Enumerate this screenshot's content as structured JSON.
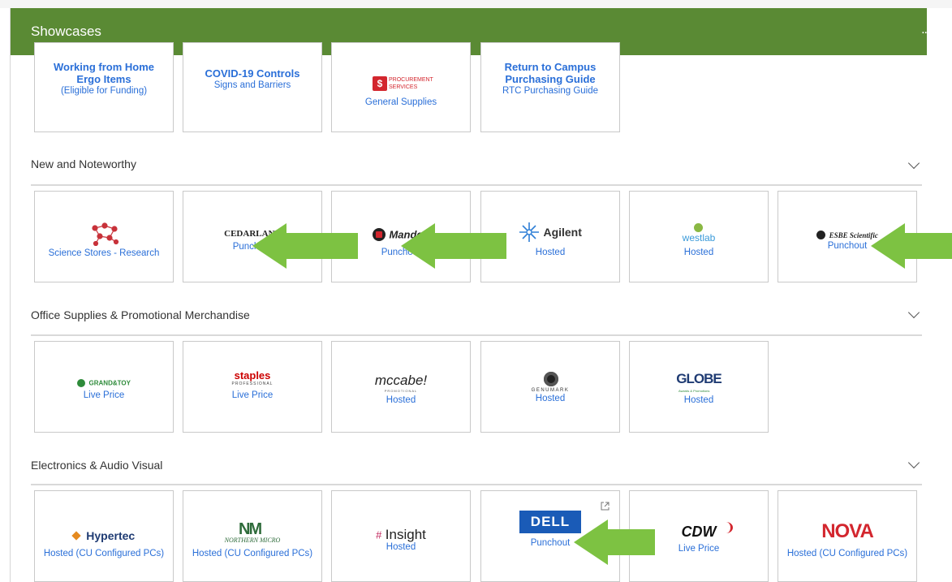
{
  "header": {
    "title": "Showcases",
    "more_label": ".."
  },
  "showcase_tiles": [
    {
      "title_line1": "Working from Home",
      "title_line2": "Ergo Items",
      "caption": "(Eligible for Funding)"
    },
    {
      "title_line1": "COVID-19 Controls",
      "caption": "Signs and Barriers"
    },
    {
      "logo_line1": "PROCUREMENT",
      "logo_line2": "SERVICES",
      "caption": "General Supplies"
    },
    {
      "title_line1": "Return to Campus",
      "title_line2": "Purchasing Guide",
      "caption": "RTC Purchasing Guide"
    }
  ],
  "sections": [
    {
      "title": "New and Noteworthy",
      "tiles": [
        {
          "logo": "",
          "caption": "Science Stores - Research"
        },
        {
          "logo": "CEDARLANE",
          "caption": "Punchout"
        },
        {
          "logo": "Mandel",
          "caption": "Punchout"
        },
        {
          "logo": "Agilent",
          "caption": "Hosted"
        },
        {
          "logo": "westlab",
          "caption": "Hosted"
        },
        {
          "logo": "ESBE Scientific",
          "caption": "Punchout"
        }
      ]
    },
    {
      "title": "Office Supplies & Promotional Merchandise",
      "tiles": [
        {
          "logo": "GRAND&TOY",
          "caption": "Live Price"
        },
        {
          "logo": "staples",
          "logo_sub": "PROFESSIONAL",
          "caption": "Live Price"
        },
        {
          "logo": "mccabe!",
          "logo_sub": "PROMOTIONAL",
          "caption": "Hosted"
        },
        {
          "logo": "GENUMARK",
          "caption": "Hosted"
        },
        {
          "logo": "GLOBE",
          "logo_sub": "Awards & Promotions",
          "caption": "Hosted"
        }
      ]
    },
    {
      "title": "Electronics & Audio Visual",
      "tiles": [
        {
          "logo": "Hypertec",
          "caption": "Hosted (CU Configured PCs)"
        },
        {
          "logo": "NORTHERN MICRO",
          "caption": "Hosted (CU Configured PCs)"
        },
        {
          "logo": "Insight",
          "caption": "Hosted"
        },
        {
          "logo": "DELL",
          "caption": "Punchout"
        },
        {
          "logo": "CDW",
          "caption": "Live Price"
        },
        {
          "logo": "NOVA",
          "caption": "Hosted (CU Configured PCs)"
        }
      ]
    }
  ],
  "colors": {
    "header_green": "#5a8a34",
    "link_blue": "#2a6fd8",
    "arrow_green": "#7dc242"
  }
}
